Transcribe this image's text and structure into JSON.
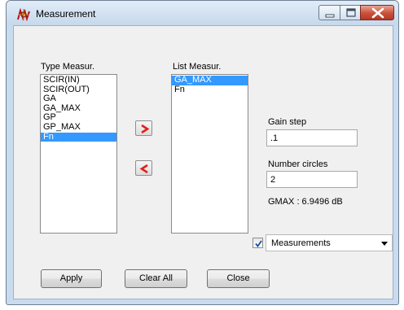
{
  "window": {
    "title": "Measurement",
    "controls": {
      "minimize": "minimize-icon",
      "maximize": "maximize-icon",
      "close": "close-icon"
    }
  },
  "type_list": {
    "label": "Type Measur.",
    "items": [
      "SCIR(IN)",
      "SCIR(OUT)",
      "GA",
      "GA_MAX",
      "GP",
      "GP_MAX",
      "Fn"
    ],
    "selected_index": 6
  },
  "measure_list": {
    "label": "List Measur.",
    "items": [
      "GA_MAX",
      "Fn"
    ],
    "selected_index": 0
  },
  "move_buttons": {
    "add": ">",
    "remove": "<"
  },
  "gain_step": {
    "label": "Gain step",
    "value": ".1"
  },
  "number_circles": {
    "label": "Number circles",
    "value": "2"
  },
  "gmax_text": "GMAX : 6.9496 dB",
  "measurements_option": {
    "checked": true,
    "value": "Measurements"
  },
  "buttons": {
    "apply": "Apply",
    "clear_all": "Clear All",
    "close": "Close"
  },
  "colors": {
    "selection": "#3399ff",
    "arrow": "#e0201b",
    "titlebar": "#c6d8ec",
    "close_button": "#c9503a"
  }
}
